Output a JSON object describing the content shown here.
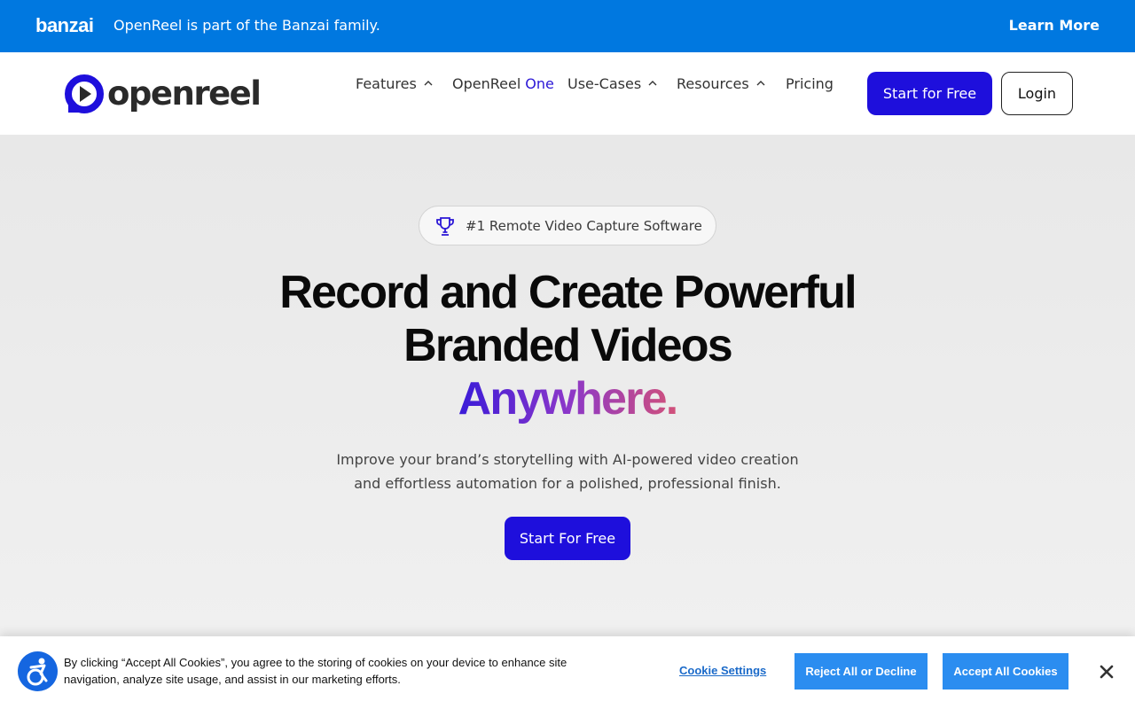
{
  "banner": {
    "logo": "banzai",
    "text": "OpenReel is part of the Banzai family.",
    "link": "Learn More",
    "color": "#0078e0"
  },
  "header": {
    "logo_text": "openreel",
    "logo_icon": "play-circle-icon",
    "brand_color": "#1e0fdc",
    "nav": {
      "features": "Features",
      "openreel_one_prefix": "OpenReel",
      "openreel_one_suffix": "One",
      "use_cases": "Use-Cases",
      "resources": "Resources",
      "pricing": "Pricing"
    },
    "start_button": "Start for Free",
    "login_button": "Login"
  },
  "hero": {
    "badge_icon": "trophy-icon",
    "badge": "#1 Remote Video Capture Software",
    "headline_line1": "Record and Create Powerful",
    "headline_line2": "Branded Videos",
    "headline_line3": "Anywhere.",
    "sub_line1": "Improve your brand’s storytelling with AI-powered video creation",
    "sub_line2": "and effortless automation for a polished, professional finish.",
    "cta": "Start For Free"
  },
  "cookie": {
    "icon": "accessibility-icon",
    "text_line1": "By clicking “Accept All Cookies”, you agree to the storing of cookies on your device to enhance site",
    "text_line2": "navigation, analyze site usage, and assist in our marketing efforts.",
    "settings": "Cookie Settings",
    "reject": "Reject All or Decline",
    "accept": "Accept All Cookies",
    "button_color": "#2b8df0"
  }
}
